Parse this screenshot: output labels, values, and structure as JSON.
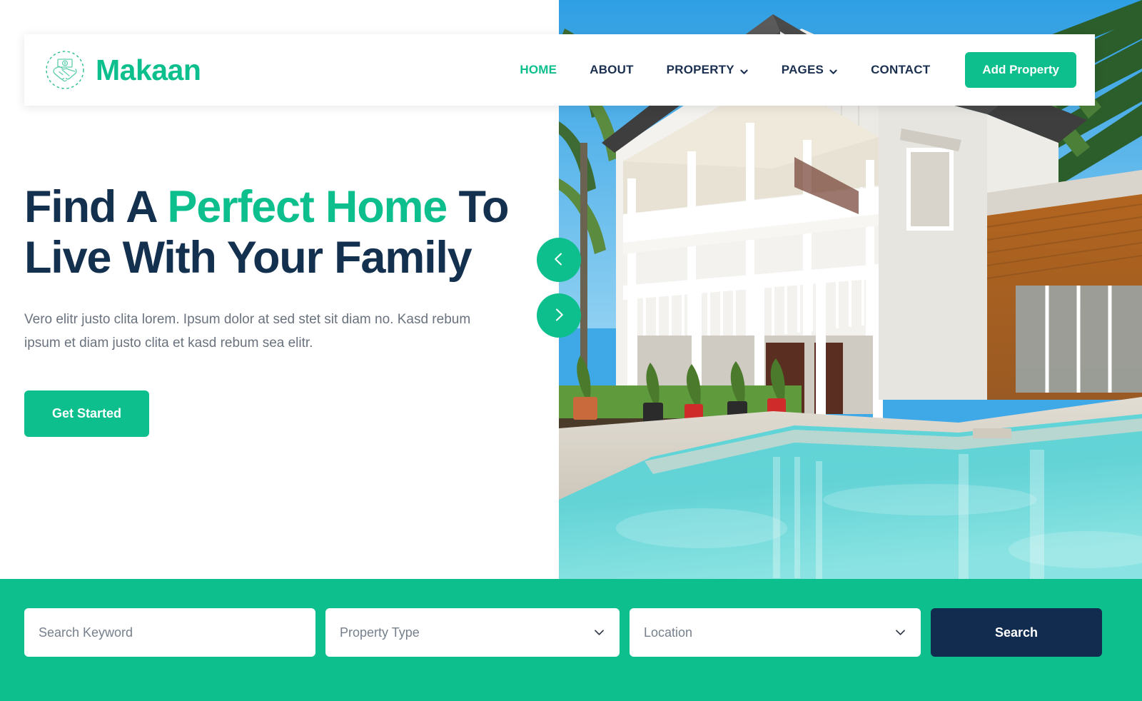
{
  "brand": {
    "name": "Makaan",
    "logo_icon": "handshake-money-icon"
  },
  "nav": {
    "items": [
      {
        "label": "HOME",
        "active": true,
        "has_dropdown": false
      },
      {
        "label": "ABOUT",
        "active": false,
        "has_dropdown": false
      },
      {
        "label": "PROPERTY",
        "active": false,
        "has_dropdown": true
      },
      {
        "label": "PAGES",
        "active": false,
        "has_dropdown": true
      },
      {
        "label": "CONTACT",
        "active": false,
        "has_dropdown": false
      }
    ],
    "cta_label": "Add Property"
  },
  "hero": {
    "headline_part1": "Find A ",
    "headline_accent": "Perfect Home",
    "headline_part2": " To Live With Your Family",
    "description": "Vero elitr justo clita lorem. Ipsum dolor at sed stet sit diam no. Kasd rebum ipsum et diam justo clita et kasd rebum sea elitr.",
    "cta_label": "Get Started",
    "carousel": {
      "prev_icon": "chevron-left-icon",
      "next_icon": "chevron-right-icon"
    },
    "image_alt": "White two-storey house with verandah and swimming pool"
  },
  "search": {
    "keyword_placeholder": "Search Keyword",
    "keyword_value": "",
    "property_type_value": "Property Type",
    "location_value": "Location",
    "button_label": "Search",
    "dropdown_icon": "chevron-down-icon"
  },
  "colors": {
    "accent_green": "#0cbf8c",
    "navy": "#14304f",
    "button_navy": "#122c4f",
    "body_text": "#69727d",
    "placeholder": "#76808c"
  }
}
